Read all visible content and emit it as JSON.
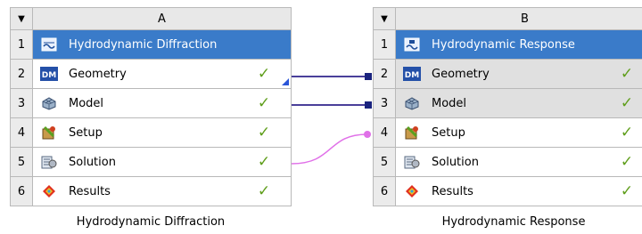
{
  "systems": [
    {
      "letter": "A",
      "header_arrow": "▼",
      "caption": "Hydrodynamic Diffraction",
      "rows": [
        {
          "num": "1",
          "label": "Hydrodynamic Diffraction",
          "icon": "hydrodynamic-diffraction-icon",
          "check": ""
        },
        {
          "num": "2",
          "label": "Geometry",
          "icon": "design-modeler-icon",
          "check": "✓"
        },
        {
          "num": "3",
          "label": "Model",
          "icon": "model-mesh-icon",
          "check": "✓"
        },
        {
          "num": "4",
          "label": "Setup",
          "icon": "setup-icon",
          "check": "✓"
        },
        {
          "num": "5",
          "label": "Solution",
          "icon": "solution-icon",
          "check": "✓"
        },
        {
          "num": "6",
          "label": "Results",
          "icon": "results-icon",
          "check": "✓"
        }
      ]
    },
    {
      "letter": "B",
      "header_arrow": "▼",
      "caption": "Hydrodynamic Response",
      "rows": [
        {
          "num": "1",
          "label": "Hydrodynamic Response",
          "icon": "hydrodynamic-response-icon",
          "check": ""
        },
        {
          "num": "2",
          "label": "Geometry",
          "icon": "design-modeler-icon",
          "check": "✓"
        },
        {
          "num": "3",
          "label": "Model",
          "icon": "model-mesh-icon",
          "check": "✓"
        },
        {
          "num": "4",
          "label": "Setup",
          "icon": "setup-icon",
          "check": "✓"
        },
        {
          "num": "5",
          "label": "Solution",
          "icon": "solution-icon",
          "check": "✓"
        },
        {
          "num": "6",
          "label": "Results",
          "icon": "results-icon",
          "check": "✓"
        }
      ]
    }
  ],
  "colors": {
    "title_row": "#3a7bc9",
    "check": "#5f9e1b",
    "share_link": "#4a3f9a",
    "transfer_link": "#e070e8"
  }
}
